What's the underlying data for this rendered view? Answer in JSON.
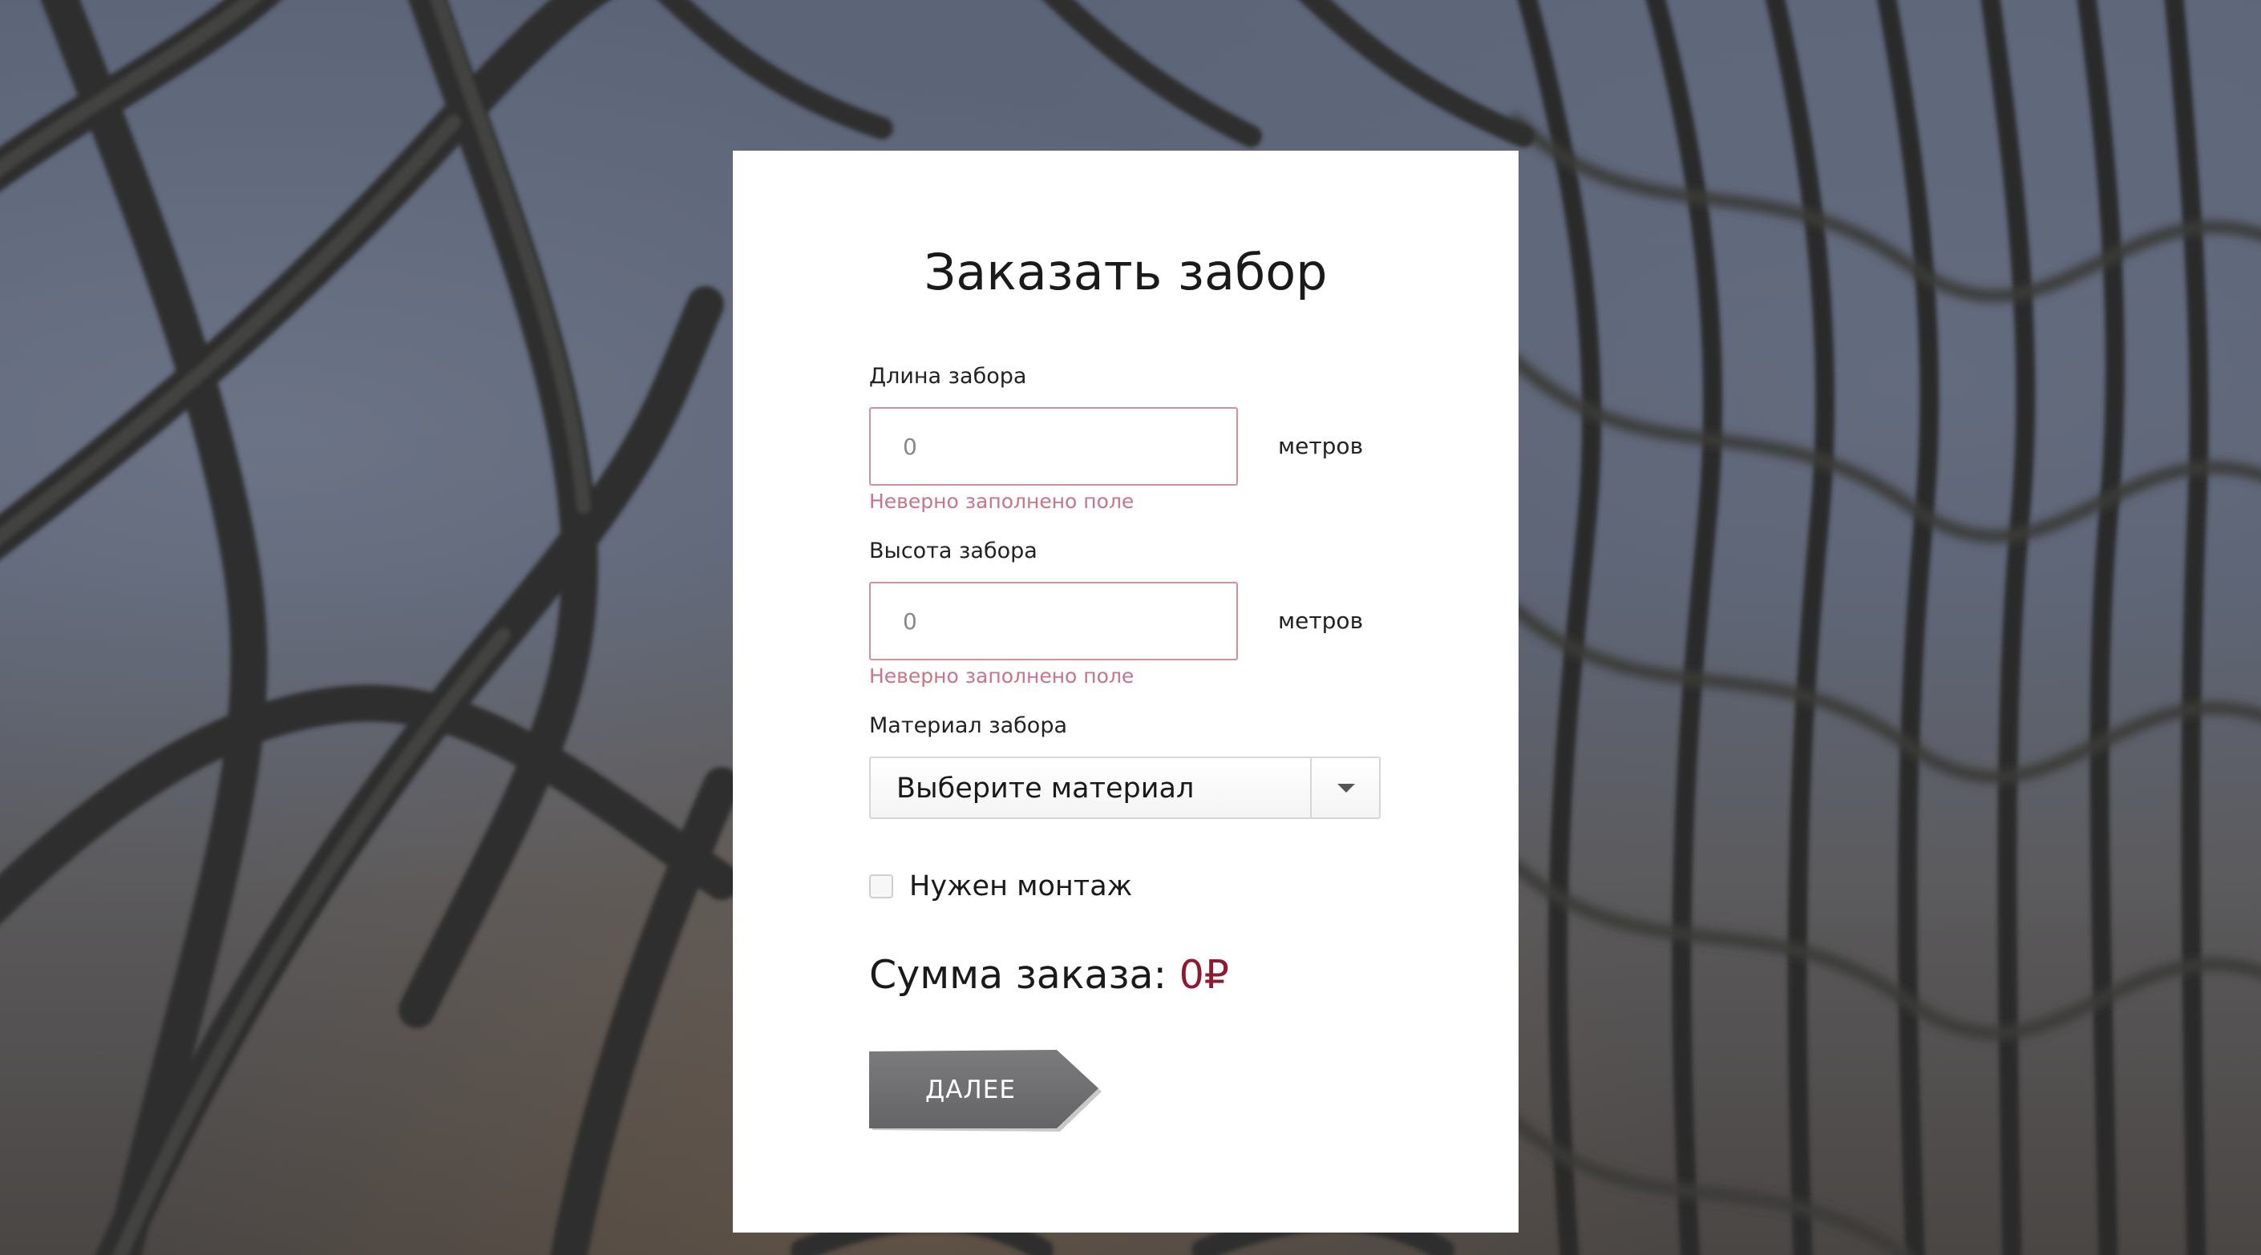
{
  "form": {
    "title": "Заказать забор",
    "length": {
      "label": "Длина забора",
      "placeholder": "0",
      "unit": "метров",
      "error": "Неверно заполнено поле"
    },
    "height": {
      "label": "Высота забора",
      "placeholder": "0",
      "unit": "метров",
      "error": "Неверно заполнено поле"
    },
    "material": {
      "label": "Материал забора",
      "selected": "Выберите материал"
    },
    "installation": {
      "label": "Нужен монтаж",
      "checked": false
    },
    "total": {
      "label": "Сумма заказа:",
      "value": "0₽"
    },
    "next_button": "ДАЛЕЕ"
  },
  "colors": {
    "error": "#c97487",
    "input_error_border": "#d38f9e",
    "total_value": "#8e1a32",
    "button": "#6e6e70"
  },
  "icons": {
    "select_arrow": "chevron-down-icon"
  }
}
